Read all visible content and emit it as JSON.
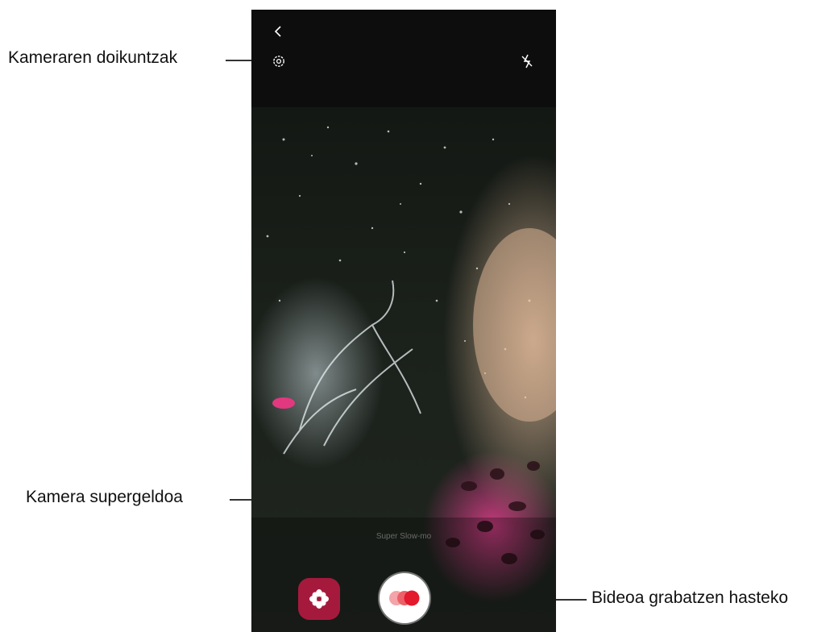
{
  "callouts": {
    "camera_settings": "Kameraren doikuntzak",
    "super_slow_mo": "Kamera supergeldoa",
    "start_recording": "Bideoa grabatzen hasteko"
  },
  "screen": {
    "mode_label": "Super Slow-mo"
  },
  "colors": {
    "effect_button": "#a51a3c",
    "record_dot": "#e3192d"
  },
  "icons": [
    "back-icon",
    "settings-icon",
    "flash-off-icon",
    "flower-icon",
    "record-icon"
  ]
}
